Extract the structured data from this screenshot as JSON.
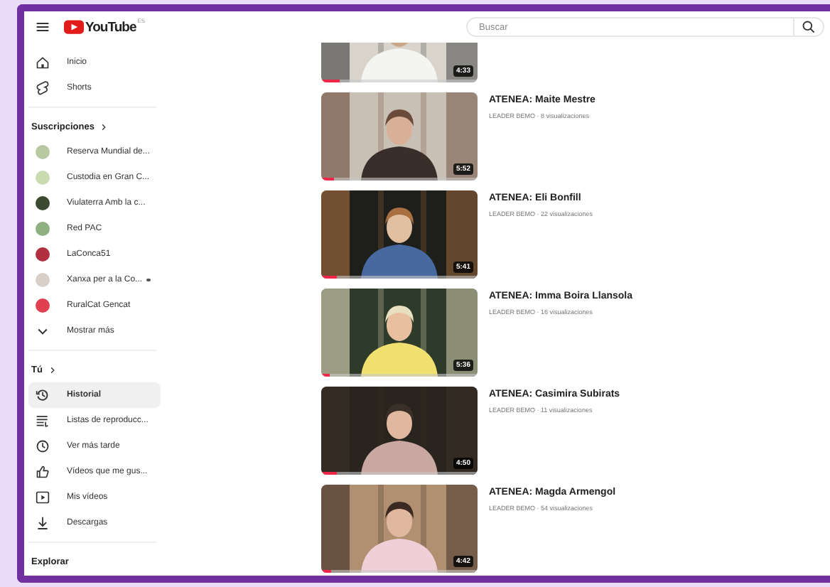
{
  "header": {
    "logo": "YouTube",
    "country": "ES",
    "search": {
      "placeholder": "Buscar"
    }
  },
  "sidebar": {
    "main": [
      {
        "label": "Inicio"
      },
      {
        "label": "Shorts"
      }
    ],
    "subscriptions_heading": "Suscripciones",
    "subscriptions": [
      {
        "label": "Reserva Mundial de...",
        "color": "#b8c8a0",
        "new": false
      },
      {
        "label": "Custodia en Gran C...",
        "color": "#c8dcb0",
        "new": false
      },
      {
        "label": "Viulaterra Amb la c...",
        "color": "#3a4a30",
        "new": false
      },
      {
        "label": "Red PAC",
        "color": "#8fb080",
        "new": false
      },
      {
        "label": "LaConca51",
        "color": "#b03040",
        "new": false
      },
      {
        "label": "Xanxa per a la Co...",
        "color": "#d8d0c8",
        "new": true
      },
      {
        "label": "RuralCat Gencat",
        "color": "#e04050",
        "new": false
      }
    ],
    "show_more": "Mostrar más",
    "you_heading": "Tú",
    "you": [
      {
        "label": "Historial",
        "selected": true
      },
      {
        "label": "Listas de reproducc...",
        "selected": false
      },
      {
        "label": "Ver más tarde",
        "selected": false
      },
      {
        "label": "Vídeos que me gus...",
        "selected": false
      },
      {
        "label": "Mis vídeos",
        "selected": false
      },
      {
        "label": "Descargas",
        "selected": false
      }
    ],
    "explore_heading": "Explorar"
  },
  "videos": [
    {
      "duration": "4:33",
      "level": 0.12
    },
    {
      "title": "ATENEA: Maite Mestre",
      "meta": "LEADER BEMO · 8 visualizaciones",
      "duration": "5:52",
      "level": 0.08
    },
    {
      "title": "ATENEA: Eli Bonfill",
      "meta": "LEADER BEMO · 22 visualizaciones",
      "duration": "5:41",
      "level": 0.1
    },
    {
      "title": "ATENEA: Imma  Boira Llansola",
      "meta": "LEADER BEMO · 16 visualizaciones",
      "duration": "5:36",
      "level": 0.05
    },
    {
      "title": "ATENEA: Casimira Subirats",
      "meta": "LEADER BEMO · 11 visualizaciones",
      "duration": "4:50",
      "level": 0.1
    },
    {
      "title": "ATENEA: Magda Armengol",
      "meta": "LEADER BEMO · 54 visualizaciones",
      "duration": "4:42",
      "level": 0.06
    }
  ]
}
